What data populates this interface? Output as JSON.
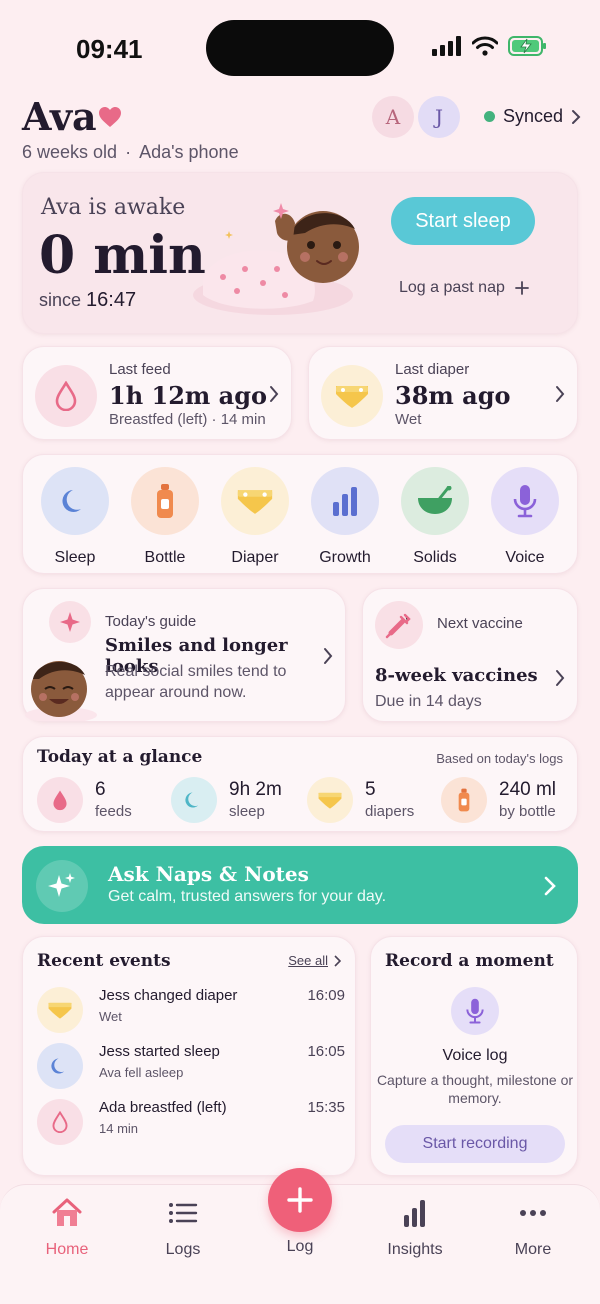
{
  "status_bar": {
    "time": "09:41"
  },
  "header": {
    "name": "Ava",
    "age": "6 weeks old",
    "separator": "·",
    "device": "Ada's phone",
    "avatars": [
      "A",
      "J"
    ],
    "sync_label": "Synced"
  },
  "hero": {
    "status": "Ava is awake",
    "duration": "0 min",
    "since_label": "since",
    "since_time": "16:47",
    "start_sleep_label": "Start sleep",
    "past_nap_label": "Log a past nap"
  },
  "last_feed": {
    "label": "Last feed",
    "value": "1h 12m ago",
    "detail": "Breastfed (left) · 14 min"
  },
  "last_diaper": {
    "label": "Last diaper",
    "value": "38m ago",
    "detail": "Wet"
  },
  "quick_actions": [
    {
      "label": "Sleep",
      "icon": "moon-icon"
    },
    {
      "label": "Bottle",
      "icon": "bottle-icon"
    },
    {
      "label": "Diaper",
      "icon": "diaper-icon"
    },
    {
      "label": "Growth",
      "icon": "bar-chart-icon"
    },
    {
      "label": "Solids",
      "icon": "bowl-icon"
    },
    {
      "label": "Voice",
      "icon": "microphone-icon"
    }
  ],
  "guide": {
    "label": "Today's guide",
    "title": "Smiles and longer looks",
    "description": "Real social smiles tend to appear around now."
  },
  "vaccine": {
    "label": "Next vaccine",
    "title": "8-week vaccines",
    "due": "Due in 14 days"
  },
  "glance": {
    "title": "Today at a glance",
    "note": "Based on today's logs",
    "items": [
      {
        "value": "6",
        "unit": "feeds"
      },
      {
        "value": "9h 2m",
        "unit": "sleep"
      },
      {
        "value": "5",
        "unit": "diapers"
      },
      {
        "value": "240 ml",
        "unit": "by bottle"
      }
    ]
  },
  "ask": {
    "title": "Ask Naps & Notes",
    "subtitle": "Get calm, trusted answers for your day."
  },
  "recent": {
    "title": "Recent events",
    "see_all": "See all",
    "events": [
      {
        "title": "Jess changed diaper",
        "detail": "Wet",
        "time": "16:09"
      },
      {
        "title": "Jess started sleep",
        "detail": "Ava fell asleep",
        "time": "16:05"
      },
      {
        "title": "Ada breastfed (left)",
        "detail": "14 min",
        "time": "15:35"
      }
    ]
  },
  "record": {
    "title": "Record a moment",
    "label": "Voice log",
    "description": "Capture a thought, milestone or memory.",
    "button": "Start recording"
  },
  "tabs": [
    {
      "label": "Home",
      "active": true
    },
    {
      "label": "Logs"
    },
    {
      "label": "Log"
    },
    {
      "label": "Insights"
    },
    {
      "label": "More"
    }
  ],
  "colors": {
    "background": "#fdeef1",
    "accent_pink": "#ef6079",
    "teal": "#3dbfa3",
    "sky": "#59c8d6",
    "synced_green": "#43b27e"
  }
}
